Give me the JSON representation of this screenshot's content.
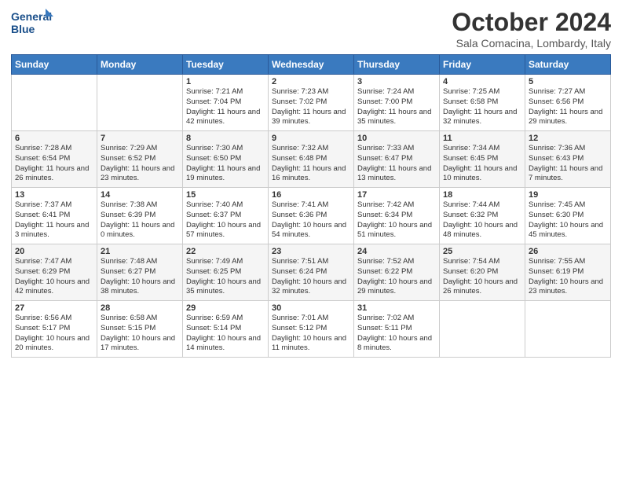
{
  "logo": {
    "line1": "General",
    "line2": "Blue"
  },
  "title": "October 2024",
  "subtitle": "Sala Comacina, Lombardy, Italy",
  "days_of_week": [
    "Sunday",
    "Monday",
    "Tuesday",
    "Wednesday",
    "Thursday",
    "Friday",
    "Saturday"
  ],
  "weeks": [
    [
      {
        "day": "",
        "info": ""
      },
      {
        "day": "",
        "info": ""
      },
      {
        "day": "1",
        "info": "Sunrise: 7:21 AM\nSunset: 7:04 PM\nDaylight: 11 hours and 42 minutes."
      },
      {
        "day": "2",
        "info": "Sunrise: 7:23 AM\nSunset: 7:02 PM\nDaylight: 11 hours and 39 minutes."
      },
      {
        "day": "3",
        "info": "Sunrise: 7:24 AM\nSunset: 7:00 PM\nDaylight: 11 hours and 35 minutes."
      },
      {
        "day": "4",
        "info": "Sunrise: 7:25 AM\nSunset: 6:58 PM\nDaylight: 11 hours and 32 minutes."
      },
      {
        "day": "5",
        "info": "Sunrise: 7:27 AM\nSunset: 6:56 PM\nDaylight: 11 hours and 29 minutes."
      }
    ],
    [
      {
        "day": "6",
        "info": "Sunrise: 7:28 AM\nSunset: 6:54 PM\nDaylight: 11 hours and 26 minutes."
      },
      {
        "day": "7",
        "info": "Sunrise: 7:29 AM\nSunset: 6:52 PM\nDaylight: 11 hours and 23 minutes."
      },
      {
        "day": "8",
        "info": "Sunrise: 7:30 AM\nSunset: 6:50 PM\nDaylight: 11 hours and 19 minutes."
      },
      {
        "day": "9",
        "info": "Sunrise: 7:32 AM\nSunset: 6:48 PM\nDaylight: 11 hours and 16 minutes."
      },
      {
        "day": "10",
        "info": "Sunrise: 7:33 AM\nSunset: 6:47 PM\nDaylight: 11 hours and 13 minutes."
      },
      {
        "day": "11",
        "info": "Sunrise: 7:34 AM\nSunset: 6:45 PM\nDaylight: 11 hours and 10 minutes."
      },
      {
        "day": "12",
        "info": "Sunrise: 7:36 AM\nSunset: 6:43 PM\nDaylight: 11 hours and 7 minutes."
      }
    ],
    [
      {
        "day": "13",
        "info": "Sunrise: 7:37 AM\nSunset: 6:41 PM\nDaylight: 11 hours and 3 minutes."
      },
      {
        "day": "14",
        "info": "Sunrise: 7:38 AM\nSunset: 6:39 PM\nDaylight: 11 hours and 0 minutes."
      },
      {
        "day": "15",
        "info": "Sunrise: 7:40 AM\nSunset: 6:37 PM\nDaylight: 10 hours and 57 minutes."
      },
      {
        "day": "16",
        "info": "Sunrise: 7:41 AM\nSunset: 6:36 PM\nDaylight: 10 hours and 54 minutes."
      },
      {
        "day": "17",
        "info": "Sunrise: 7:42 AM\nSunset: 6:34 PM\nDaylight: 10 hours and 51 minutes."
      },
      {
        "day": "18",
        "info": "Sunrise: 7:44 AM\nSunset: 6:32 PM\nDaylight: 10 hours and 48 minutes."
      },
      {
        "day": "19",
        "info": "Sunrise: 7:45 AM\nSunset: 6:30 PM\nDaylight: 10 hours and 45 minutes."
      }
    ],
    [
      {
        "day": "20",
        "info": "Sunrise: 7:47 AM\nSunset: 6:29 PM\nDaylight: 10 hours and 42 minutes."
      },
      {
        "day": "21",
        "info": "Sunrise: 7:48 AM\nSunset: 6:27 PM\nDaylight: 10 hours and 38 minutes."
      },
      {
        "day": "22",
        "info": "Sunrise: 7:49 AM\nSunset: 6:25 PM\nDaylight: 10 hours and 35 minutes."
      },
      {
        "day": "23",
        "info": "Sunrise: 7:51 AM\nSunset: 6:24 PM\nDaylight: 10 hours and 32 minutes."
      },
      {
        "day": "24",
        "info": "Sunrise: 7:52 AM\nSunset: 6:22 PM\nDaylight: 10 hours and 29 minutes."
      },
      {
        "day": "25",
        "info": "Sunrise: 7:54 AM\nSunset: 6:20 PM\nDaylight: 10 hours and 26 minutes."
      },
      {
        "day": "26",
        "info": "Sunrise: 7:55 AM\nSunset: 6:19 PM\nDaylight: 10 hours and 23 minutes."
      }
    ],
    [
      {
        "day": "27",
        "info": "Sunrise: 6:56 AM\nSunset: 5:17 PM\nDaylight: 10 hours and 20 minutes."
      },
      {
        "day": "28",
        "info": "Sunrise: 6:58 AM\nSunset: 5:15 PM\nDaylight: 10 hours and 17 minutes."
      },
      {
        "day": "29",
        "info": "Sunrise: 6:59 AM\nSunset: 5:14 PM\nDaylight: 10 hours and 14 minutes."
      },
      {
        "day": "30",
        "info": "Sunrise: 7:01 AM\nSunset: 5:12 PM\nDaylight: 10 hours and 11 minutes."
      },
      {
        "day": "31",
        "info": "Sunrise: 7:02 AM\nSunset: 5:11 PM\nDaylight: 10 hours and 8 minutes."
      },
      {
        "day": "",
        "info": ""
      },
      {
        "day": "",
        "info": ""
      }
    ]
  ]
}
